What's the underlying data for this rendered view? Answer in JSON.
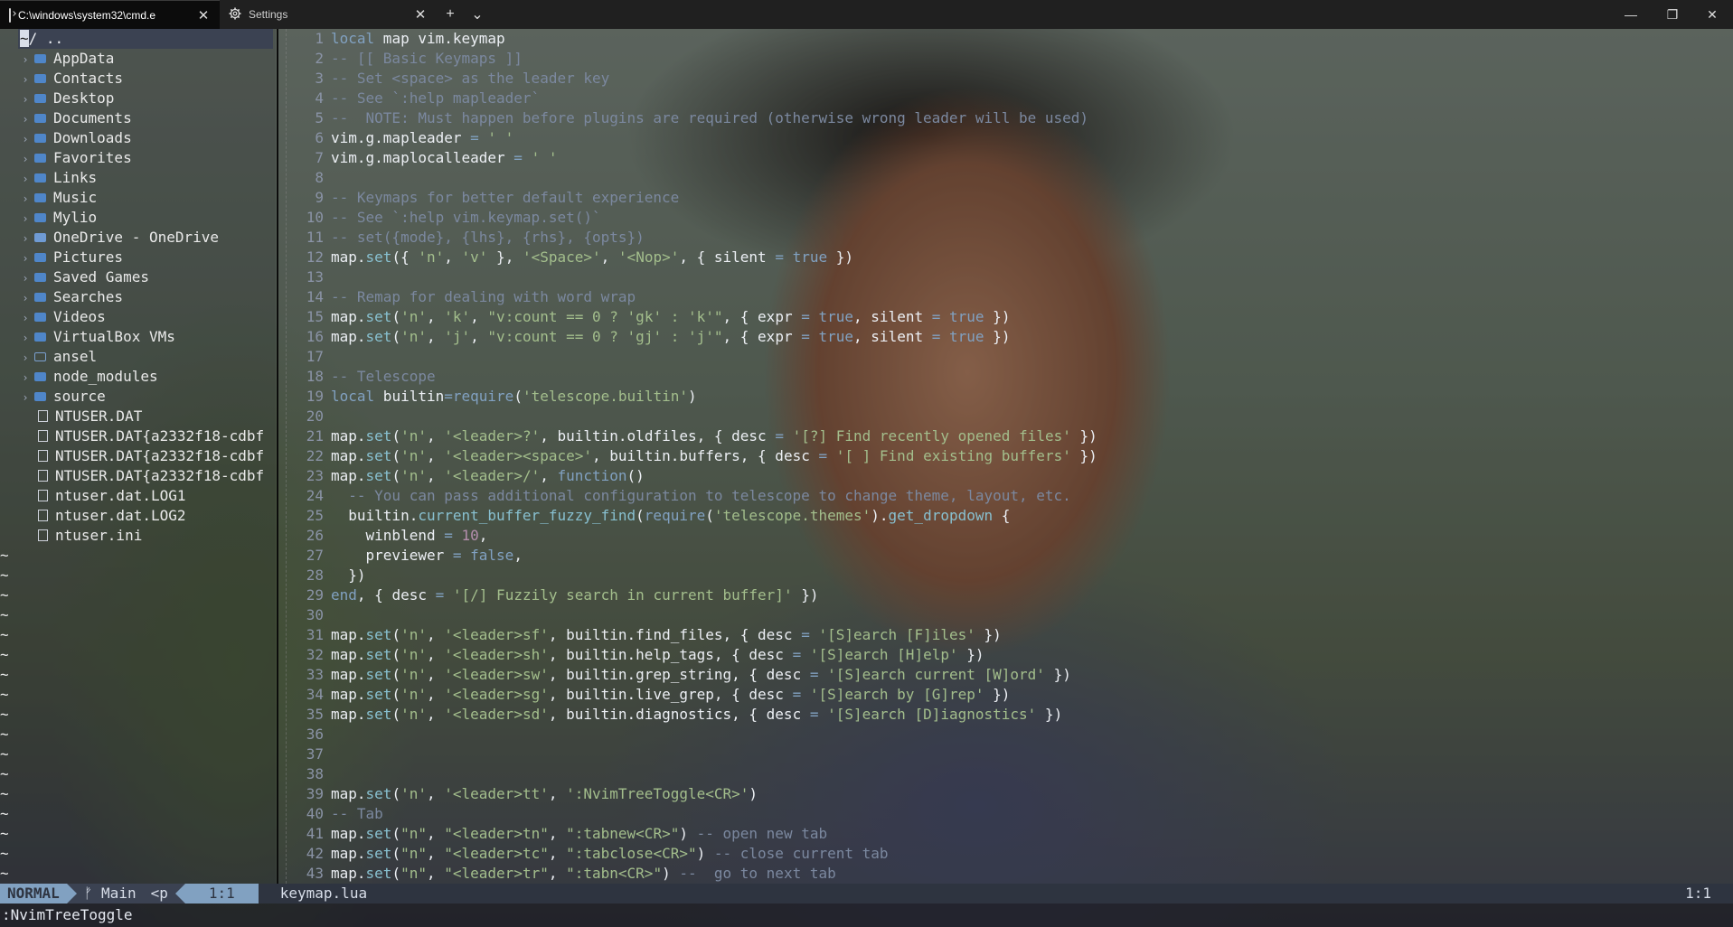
{
  "window": {
    "tabs": [
      {
        "title": "C:\\windows\\system32\\cmd.e",
        "icon": "terminal-icon",
        "active": true
      },
      {
        "title": "Settings",
        "icon": "gear-icon",
        "active": false
      }
    ],
    "new_tab": "+",
    "dropdown": "⌄",
    "close": "✕",
    "controls": {
      "minimize": "—",
      "maximize": "❐",
      "close": "✕"
    }
  },
  "tree": {
    "header": "~/ ..",
    "items": [
      {
        "name": "AppData",
        "type": "dir"
      },
      {
        "name": "Contacts",
        "type": "dir"
      },
      {
        "name": "Desktop",
        "type": "dir"
      },
      {
        "name": "Documents",
        "type": "dir"
      },
      {
        "name": "Downloads",
        "type": "dir"
      },
      {
        "name": "Favorites",
        "type": "dir"
      },
      {
        "name": "Links",
        "type": "dir"
      },
      {
        "name": "Music",
        "type": "dir"
      },
      {
        "name": "Mylio",
        "type": "dir"
      },
      {
        "name": "OneDrive - OneDrive",
        "type": "sync"
      },
      {
        "name": "Pictures",
        "type": "dir"
      },
      {
        "name": "Saved Games",
        "type": "dir"
      },
      {
        "name": "Searches",
        "type": "dir"
      },
      {
        "name": "Videos",
        "type": "dir"
      },
      {
        "name": "VirtualBox VMs",
        "type": "dir"
      },
      {
        "name": "ansel",
        "type": "empty"
      },
      {
        "name": "node_modules",
        "type": "dir"
      },
      {
        "name": "source",
        "type": "dir"
      },
      {
        "name": "NTUSER.DAT",
        "type": "file"
      },
      {
        "name": "NTUSER.DAT{a2332f18-cdbf",
        "type": "file"
      },
      {
        "name": "NTUSER.DAT{a2332f18-cdbf",
        "type": "file"
      },
      {
        "name": "NTUSER.DAT{a2332f18-cdbf",
        "type": "file"
      },
      {
        "name": "ntuser.dat.LOG1",
        "type": "file"
      },
      {
        "name": "ntuser.dat.LOG2",
        "type": "file"
      },
      {
        "name": "ntuser.ini",
        "type": "file"
      }
    ],
    "tilde": "~",
    "tilde_count": 18
  },
  "editor": {
    "lines": [
      {
        "n": "1",
        "t": "local map vim.keymap"
      },
      {
        "n": "2",
        "t": "-- [[ Basic Keymaps ]]"
      },
      {
        "n": "3",
        "t": "-- Set <space> as the leader key"
      },
      {
        "n": "4",
        "t": "-- See `:help mapleader`"
      },
      {
        "n": "5",
        "t": "--  NOTE: Must happen before plugins are required (otherwise wrong leader will be used)"
      },
      {
        "n": "6",
        "t": "vim.g.mapleader = ' '"
      },
      {
        "n": "7",
        "t": "vim.g.maplocalleader = ' '"
      },
      {
        "n": "8",
        "t": ""
      },
      {
        "n": "9",
        "t": "-- Keymaps for better default experience"
      },
      {
        "n": "10",
        "t": "-- See `:help vim.keymap.set()`"
      },
      {
        "n": "11",
        "t": "-- set({mode}, {lhs}, {rhs}, {opts})"
      },
      {
        "n": "12",
        "t": "map.set({ 'n', 'v' }, '<Space>', '<Nop>', { silent = true })"
      },
      {
        "n": "13",
        "t": ""
      },
      {
        "n": "14",
        "t": "-- Remap for dealing with word wrap"
      },
      {
        "n": "15",
        "t": "map.set('n', 'k', \"v:count == 0 ? 'gk' : 'k'\", { expr = true, silent = true })"
      },
      {
        "n": "16",
        "t": "map.set('n', 'j', \"v:count == 0 ? 'gj' : 'j'\", { expr = true, silent = true })"
      },
      {
        "n": "17",
        "t": ""
      },
      {
        "n": "18",
        "t": "-- Telescope"
      },
      {
        "n": "19",
        "t": "local builtin=require('telescope.builtin')"
      },
      {
        "n": "20",
        "t": ""
      },
      {
        "n": "21",
        "t": "map.set('n', '<leader>?', builtin.oldfiles, { desc = '[?] Find recently opened files' })"
      },
      {
        "n": "22",
        "t": "map.set('n', '<leader><space>', builtin.buffers, { desc = '[ ] Find existing buffers' })"
      },
      {
        "n": "23",
        "t": "map.set('n', '<leader>/', function()"
      },
      {
        "n": "24",
        "t": "  -- You can pass additional configuration to telescope to change theme, layout, etc."
      },
      {
        "n": "25",
        "t": "  builtin.current_buffer_fuzzy_find(require('telescope.themes').get_dropdown {"
      },
      {
        "n": "26",
        "t": "    winblend = 10,"
      },
      {
        "n": "27",
        "t": "    previewer = false,"
      },
      {
        "n": "28",
        "t": "  })"
      },
      {
        "n": "29",
        "t": "end, { desc = '[/] Fuzzily search in current buffer]' })"
      },
      {
        "n": "30",
        "t": ""
      },
      {
        "n": "31",
        "t": "map.set('n', '<leader>sf', builtin.find_files, { desc = '[S]earch [F]iles' })"
      },
      {
        "n": "32",
        "t": "map.set('n', '<leader>sh', builtin.help_tags, { desc = '[S]earch [H]elp' })"
      },
      {
        "n": "33",
        "t": "map.set('n', '<leader>sw', builtin.grep_string, { desc = '[S]earch current [W]ord' })"
      },
      {
        "n": "34",
        "t": "map.set('n', '<leader>sg', builtin.live_grep, { desc = '[S]earch by [G]rep' })"
      },
      {
        "n": "35",
        "t": "map.set('n', '<leader>sd', builtin.diagnostics, { desc = '[S]earch [D]iagnostics' })"
      },
      {
        "n": "36",
        "t": ""
      },
      {
        "n": "37",
        "t": ""
      },
      {
        "n": "38",
        "t": ""
      },
      {
        "n": "39",
        "t": "map.set('n', '<leader>tt', ':NvimTreeToggle<CR>')"
      },
      {
        "n": "40",
        "t": "-- Tab"
      },
      {
        "n": "41",
        "t": "map.set(\"n\", \"<leader>tn\", \":tabnew<CR>\") -- open new tab"
      },
      {
        "n": "42",
        "t": "map.set(\"n\", \"<leader>tc\", \":tabclose<CR>\") -- close current tab"
      },
      {
        "n": "43",
        "t": "map.set(\"n\", \"<leader>tr\", \":tabn<CR>\") --  go to next tab"
      }
    ]
  },
  "statusline": {
    "mode": "NORMAL",
    "branch_icon": "branch-icon",
    "branch": "Main",
    "extra": "<p",
    "left_pos": "1:1",
    "file": "keymap.lua",
    "right_pos": "1:1"
  },
  "cmdline": ":NvimTreeToggle"
}
